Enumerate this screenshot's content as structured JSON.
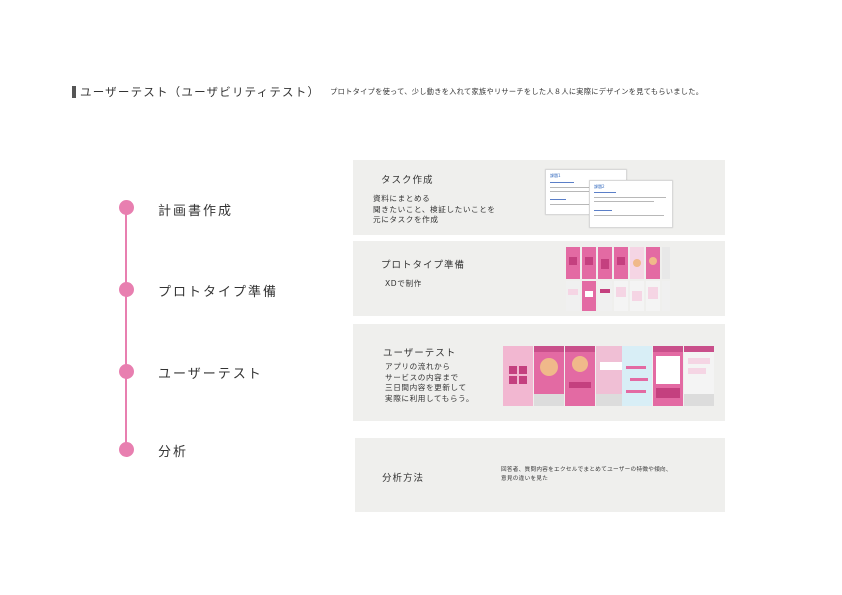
{
  "header": {
    "title": "ユーザーテスト（ユーザビリティテスト）",
    "subtitle": "プロトタイプを使って、少し動きを入れて家族やリサーチをした人８人に実際にデザインを見てもらいました。"
  },
  "timeline": {
    "steps": [
      {
        "label": "計画書作成"
      },
      {
        "label": "プロトタイプ準備"
      },
      {
        "label": "ユーザーテスト"
      },
      {
        "label": "分析"
      }
    ]
  },
  "cards": [
    {
      "title": "タスク作成",
      "lines": [
        "資料にまとめる",
        "聞きたいこと、検証したいことを",
        "元にタスクを作成"
      ]
    },
    {
      "title": "プロトタイプ準備",
      "lines": [
        "XDで制作"
      ]
    },
    {
      "title": "ユーザーテスト",
      "lines": [
        "アプリの流れから",
        "サービスの内容まで",
        "三日間内容を更新して",
        "実際に利用してもらう。"
      ]
    },
    {
      "title": "分析方法",
      "lines": [
        "回答者、質問内容をエクセルでまとめてユーザーの特徴や傾向、",
        "意見の違いを見た"
      ]
    }
  ],
  "thumbnails": {
    "doc_heading_1": "課題1",
    "doc_heading_2": "課題2"
  },
  "colors": {
    "accent": "#e87fb0",
    "card_bg": "#efefed",
    "app_pink": "#e36aa3",
    "app_dark_pink": "#c4407f"
  }
}
